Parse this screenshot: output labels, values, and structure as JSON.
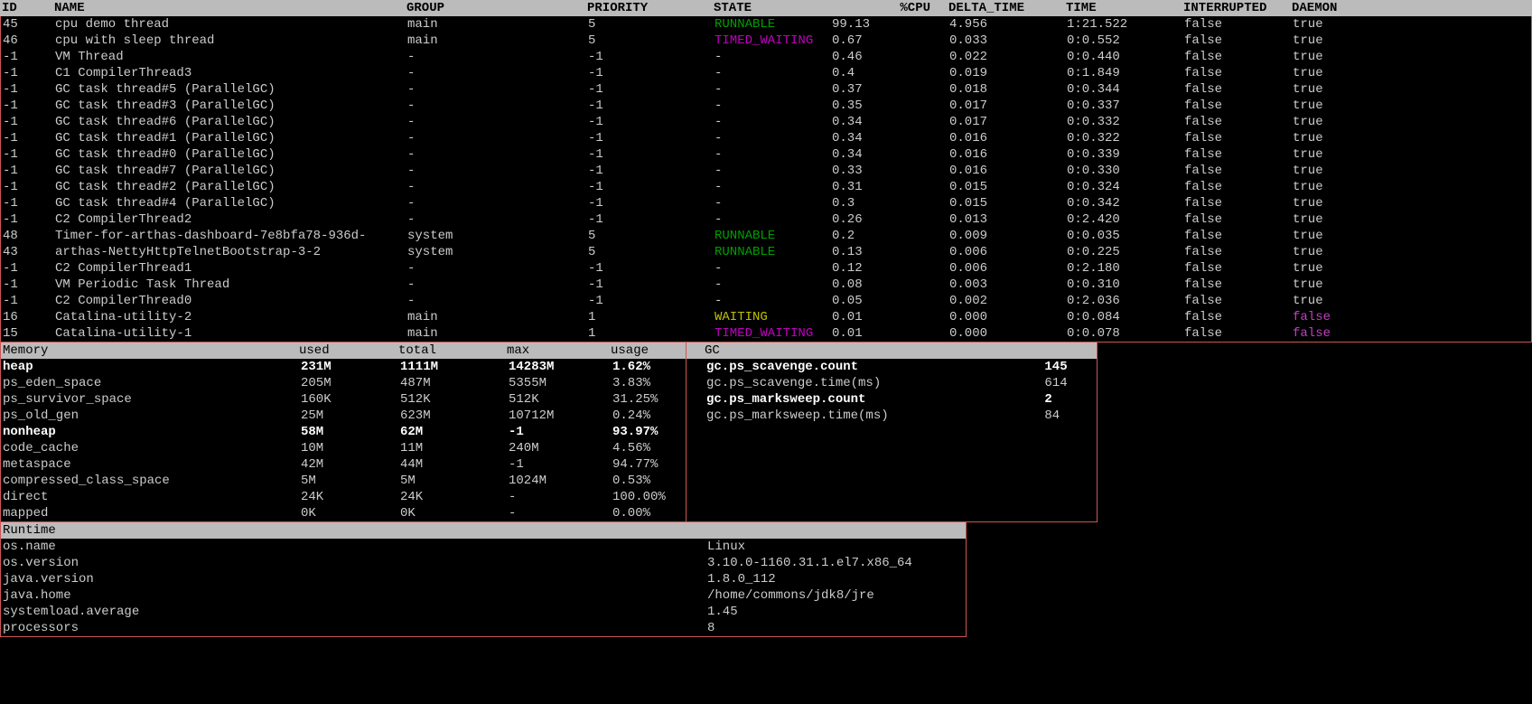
{
  "headers": {
    "id": "ID",
    "name": "NAME",
    "group": "GROUP",
    "priority": "PRIORITY",
    "state": "STATE",
    "cpu": "%CPU",
    "delta": "DELTA_TIME",
    "time": "TIME",
    "interrupted": "INTERRUPTED",
    "daemon": "DAEMON"
  },
  "threads": [
    {
      "id": "45",
      "name": "cpu demo thread",
      "group": "main",
      "priority": "5",
      "state": "RUNNABLE",
      "cpu": "99.13",
      "delta": "4.956",
      "time": "1:21.522",
      "interrupted": "false",
      "daemon": "true"
    },
    {
      "id": "46",
      "name": "cpu with sleep thread",
      "group": "main",
      "priority": "5",
      "state": "TIMED_WAITING",
      "cpu": "0.67",
      "delta": "0.033",
      "time": "0:0.552",
      "interrupted": "false",
      "daemon": "true"
    },
    {
      "id": "-1",
      "name": "VM Thread",
      "group": "-",
      "priority": "-1",
      "state": "-",
      "cpu": "0.46",
      "delta": "0.022",
      "time": "0:0.440",
      "interrupted": "false",
      "daemon": "true"
    },
    {
      "id": "-1",
      "name": "C1 CompilerThread3",
      "group": "-",
      "priority": "-1",
      "state": "-",
      "cpu": "0.4",
      "delta": "0.019",
      "time": "0:1.849",
      "interrupted": "false",
      "daemon": "true"
    },
    {
      "id": "-1",
      "name": "GC task thread#5 (ParallelGC)",
      "group": "-",
      "priority": "-1",
      "state": "-",
      "cpu": "0.37",
      "delta": "0.018",
      "time": "0:0.344",
      "interrupted": "false",
      "daemon": "true"
    },
    {
      "id": "-1",
      "name": "GC task thread#3 (ParallelGC)",
      "group": "-",
      "priority": "-1",
      "state": "-",
      "cpu": "0.35",
      "delta": "0.017",
      "time": "0:0.337",
      "interrupted": "false",
      "daemon": "true"
    },
    {
      "id": "-1",
      "name": "GC task thread#6 (ParallelGC)",
      "group": "-",
      "priority": "-1",
      "state": "-",
      "cpu": "0.34",
      "delta": "0.017",
      "time": "0:0.332",
      "interrupted": "false",
      "daemon": "true"
    },
    {
      "id": "-1",
      "name": "GC task thread#1 (ParallelGC)",
      "group": "-",
      "priority": "-1",
      "state": "-",
      "cpu": "0.34",
      "delta": "0.016",
      "time": "0:0.322",
      "interrupted": "false",
      "daemon": "true"
    },
    {
      "id": "-1",
      "name": "GC task thread#0 (ParallelGC)",
      "group": "-",
      "priority": "-1",
      "state": "-",
      "cpu": "0.34",
      "delta": "0.016",
      "time": "0:0.339",
      "interrupted": "false",
      "daemon": "true"
    },
    {
      "id": "-1",
      "name": "GC task thread#7 (ParallelGC)",
      "group": "-",
      "priority": "-1",
      "state": "-",
      "cpu": "0.33",
      "delta": "0.016",
      "time": "0:0.330",
      "interrupted": "false",
      "daemon": "true"
    },
    {
      "id": "-1",
      "name": "GC task thread#2 (ParallelGC)",
      "group": "-",
      "priority": "-1",
      "state": "-",
      "cpu": "0.31",
      "delta": "0.015",
      "time": "0:0.324",
      "interrupted": "false",
      "daemon": "true"
    },
    {
      "id": "-1",
      "name": "GC task thread#4 (ParallelGC)",
      "group": "-",
      "priority": "-1",
      "state": "-",
      "cpu": "0.3",
      "delta": "0.015",
      "time": "0:0.342",
      "interrupted": "false",
      "daemon": "true"
    },
    {
      "id": "-1",
      "name": "C2 CompilerThread2",
      "group": "-",
      "priority": "-1",
      "state": "-",
      "cpu": "0.26",
      "delta": "0.013",
      "time": "0:2.420",
      "interrupted": "false",
      "daemon": "true"
    },
    {
      "id": "48",
      "name": "Timer-for-arthas-dashboard-7e8bfa78-936d-",
      "group": "system",
      "priority": "5",
      "state": "RUNNABLE",
      "cpu": "0.2",
      "delta": "0.009",
      "time": "0:0.035",
      "interrupted": "false",
      "daemon": "true"
    },
    {
      "id": "43",
      "name": "arthas-NettyHttpTelnetBootstrap-3-2",
      "group": "system",
      "priority": "5",
      "state": "RUNNABLE",
      "cpu": "0.13",
      "delta": "0.006",
      "time": "0:0.225",
      "interrupted": "false",
      "daemon": "true"
    },
    {
      "id": "-1",
      "name": "C2 CompilerThread1",
      "group": "-",
      "priority": "-1",
      "state": "-",
      "cpu": "0.12",
      "delta": "0.006",
      "time": "0:2.180",
      "interrupted": "false",
      "daemon": "true"
    },
    {
      "id": "-1",
      "name": "VM Periodic Task Thread",
      "group": "-",
      "priority": "-1",
      "state": "-",
      "cpu": "0.08",
      "delta": "0.003",
      "time": "0:0.310",
      "interrupted": "false",
      "daemon": "true"
    },
    {
      "id": "-1",
      "name": "C2 CompilerThread0",
      "group": "-",
      "priority": "-1",
      "state": "-",
      "cpu": "0.05",
      "delta": "0.002",
      "time": "0:2.036",
      "interrupted": "false",
      "daemon": "true"
    },
    {
      "id": "16",
      "name": "Catalina-utility-2",
      "group": "main",
      "priority": "1",
      "state": "WAITING",
      "cpu": "0.01",
      "delta": "0.000",
      "time": "0:0.084",
      "interrupted": "false",
      "daemon": "false",
      "daemon_purple": true
    },
    {
      "id": "15",
      "name": "Catalina-utility-1",
      "group": "main",
      "priority": "1",
      "state": "TIMED_WAITING",
      "cpu": "0.01",
      "delta": "0.000",
      "time": "0:0.078",
      "interrupted": "false",
      "daemon": "false",
      "daemon_purple": true
    }
  ],
  "memory_header": {
    "title": "Memory",
    "used": "used",
    "total": "total",
    "max": "max",
    "usage": "usage"
  },
  "memory": [
    {
      "name": "heap",
      "used": "231M",
      "total": "1111M",
      "max": "14283M",
      "usage": "1.62%",
      "bold": true
    },
    {
      "name": "ps_eden_space",
      "used": "205M",
      "total": "487M",
      "max": "5355M",
      "usage": "3.83%"
    },
    {
      "name": "ps_survivor_space",
      "used": "160K",
      "total": "512K",
      "max": "512K",
      "usage": "31.25%"
    },
    {
      "name": "ps_old_gen",
      "used": "25M",
      "total": "623M",
      "max": "10712M",
      "usage": "0.24%"
    },
    {
      "name": "nonheap",
      "used": "58M",
      "total": "62M",
      "max": "-1",
      "usage": "93.97%",
      "bold": true
    },
    {
      "name": "code_cache",
      "used": "10M",
      "total": "11M",
      "max": "240M",
      "usage": "4.56%"
    },
    {
      "name": "metaspace",
      "used": "42M",
      "total": "44M",
      "max": "-1",
      "usage": "94.77%"
    },
    {
      "name": "compressed_class_space",
      "used": "5M",
      "total": "5M",
      "max": "1024M",
      "usage": "0.53%"
    },
    {
      "name": "direct",
      "used": "24K",
      "total": "24K",
      "max": "-",
      "usage": "100.00%"
    },
    {
      "name": "mapped",
      "used": "0K",
      "total": "0K",
      "max": "-",
      "usage": "0.00%"
    }
  ],
  "gc_header": "GC",
  "gc": [
    {
      "name": "gc.ps_scavenge.count",
      "val": "145",
      "bold": true
    },
    {
      "name": "gc.ps_scavenge.time(ms)",
      "val": "614"
    },
    {
      "name": "gc.ps_marksweep.count",
      "val": "2",
      "bold": true
    },
    {
      "name": "gc.ps_marksweep.time(ms)",
      "val": "84"
    }
  ],
  "runtime_header": "Runtime",
  "runtime": [
    {
      "name": "os.name",
      "val": "Linux"
    },
    {
      "name": "os.version",
      "val": "3.10.0-1160.31.1.el7.x86_64"
    },
    {
      "name": "java.version",
      "val": "1.8.0_112"
    },
    {
      "name": "java.home",
      "val": "/home/commons/jdk8/jre"
    },
    {
      "name": "systemload.average",
      "val": "1.45"
    },
    {
      "name": "processors",
      "val": "8"
    }
  ]
}
